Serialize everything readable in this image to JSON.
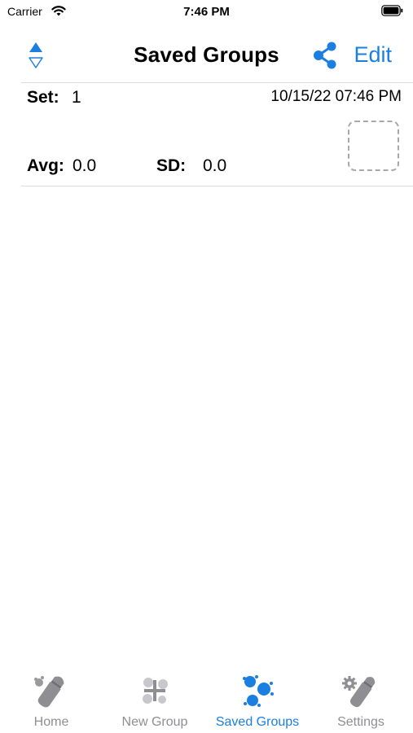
{
  "status_bar": {
    "carrier": "Carrier",
    "time": "7:46 PM",
    "wifi_icon": "wifi-icon",
    "battery_icon": "battery-icon"
  },
  "nav": {
    "title": "Saved Groups",
    "edit_label": "Edit",
    "sort_icon": "sort-icon",
    "share_icon": "share-icon"
  },
  "groups": [
    {
      "set_label": "Set:",
      "set_value": "1",
      "date": "10/15/22 07:46 PM",
      "avg_label": "Avg:",
      "avg_value": "0.0",
      "sd_label": "SD:",
      "sd_value": "0.0"
    }
  ],
  "tabs": [
    {
      "label": "Home",
      "icon": "bullet-icon",
      "active": false
    },
    {
      "label": "New Group",
      "icon": "new-group-icon",
      "active": false
    },
    {
      "label": "Saved Groups",
      "icon": "saved-groups-icon",
      "active": true
    },
    {
      "label": "Settings",
      "icon": "settings-icon",
      "active": false
    }
  ],
  "colors": {
    "accent": "#1a7fe0",
    "inactive_tab": "#8e8e93",
    "divider": "#dcdcdc"
  }
}
